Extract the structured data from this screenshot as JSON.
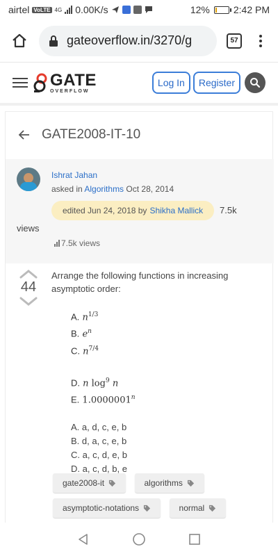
{
  "status_bar": {
    "carrier": "airtel",
    "volte": "VoLTE",
    "network": "4G",
    "speed": "0.00K/s",
    "battery": "12%",
    "battery_level": 0.12,
    "time": "2:42 PM"
  },
  "browser": {
    "url": "gateoverflow.in/3270/g",
    "tab_count": "57"
  },
  "header": {
    "logo_main": "GATE",
    "logo_sub": "OVERFLOW",
    "login_label": "Log In",
    "register_label": "Register"
  },
  "question": {
    "title": "GATE2008-IT-10",
    "author": "Ishrat Jahan",
    "asked_prefix": "asked in",
    "category": "Algorithms",
    "date": "Oct 28, 2014",
    "edited_text": "edited Jun 24, 2018 by",
    "edited_by": "Shikha Mallick",
    "views_a": "7.5k",
    "views_b": "views",
    "views_c": "7.5k views",
    "votes": "44",
    "text": "Arrange the following functions in increasing asymptotic order:",
    "options": [
      {
        "label": "A."
      },
      {
        "label": "B."
      },
      {
        "label": "C."
      },
      {
        "label": "D."
      },
      {
        "label": "E."
      }
    ],
    "answers": [
      "A. a, d, c, e, b",
      "B. d, a, c, e, b",
      "C. a, c, d, e, b",
      "D. a, c, d, b, e"
    ],
    "tags": [
      "gate2008-it",
      "algorithms",
      "asymptotic-notations",
      "normal"
    ]
  }
}
